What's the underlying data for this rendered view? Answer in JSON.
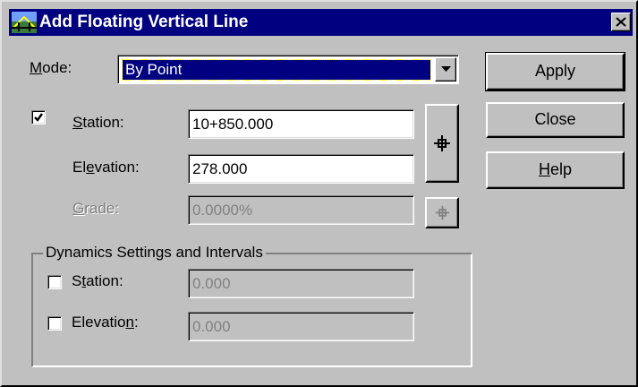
{
  "window": {
    "title": "Add Floating Vertical Line"
  },
  "mode": {
    "label": "Mode:",
    "selected": "By Point"
  },
  "station": {
    "label": "Station:",
    "value": "10+850.000",
    "checked": true
  },
  "elevation": {
    "label": "Elevation:",
    "value": "278.000"
  },
  "grade": {
    "label": "Grade:",
    "value": "0.0000%",
    "enabled": false
  },
  "dynamics": {
    "group_title": "Dynamics Settings and Intervals",
    "station": {
      "label": "Station:",
      "value": "0.000",
      "checked": false
    },
    "elevation": {
      "label": "Elevation:",
      "value": "0.000",
      "checked": false
    }
  },
  "buttons": {
    "apply": "Apply",
    "close": "Close",
    "help": "Help"
  },
  "icons": {
    "app": "bridge-icon",
    "pick": "crosshair-icon",
    "window_close": "close-icon",
    "dropdown": "chevron-down-icon"
  },
  "colors": {
    "titlebar": "#000080",
    "face": "#c0c0c0",
    "disabled_text": "#808080"
  }
}
